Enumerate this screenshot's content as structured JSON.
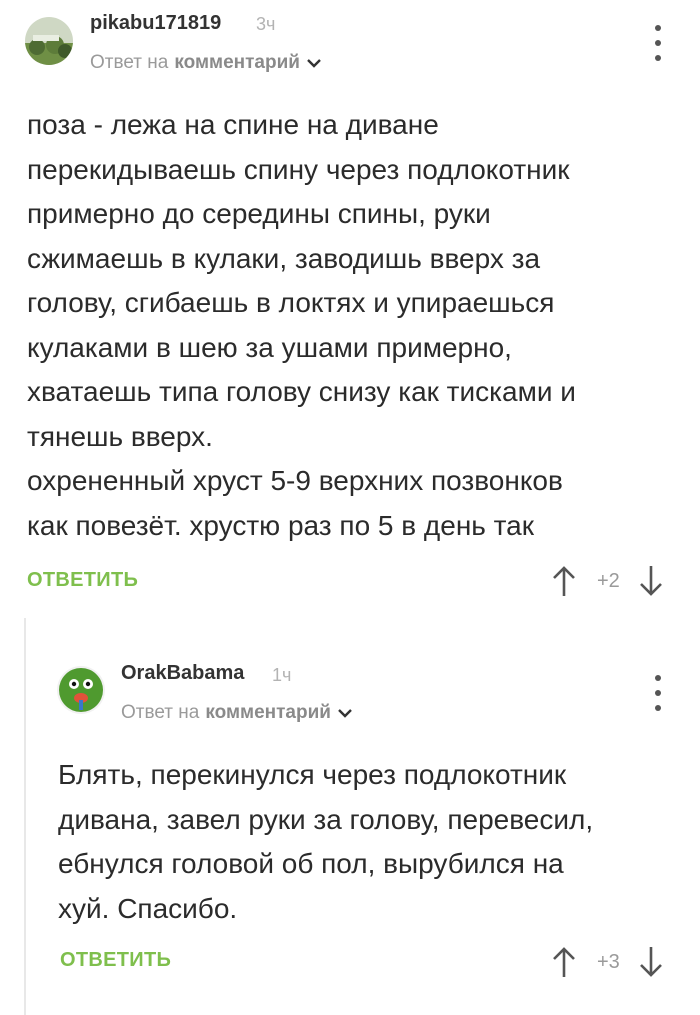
{
  "comments": [
    {
      "username": "pikabu171819",
      "time": "3ч",
      "reply_prefix": "Ответ на",
      "reply_target": "комментарий",
      "text": "поза - лежа на спине на диване\nперекидываешь спину через подлокотник\nпримерно до середины спины, руки\nсжимаешь в кулаки, заводишь вверх за\nголову, сгибаешь в локтях и упираешься\nкулаками в шею за ушами примерно,\nхватаешь типа голову снизу как тисками и\nтянешь вверх.\nохрененный хруст 5-9 верхних позвонков\nкак повезёт. хрустю раз по 5 в день так",
      "reply_label": "ОТВЕТИТЬ",
      "rating": "+2"
    },
    {
      "username": "OrakBabama",
      "time": "1ч",
      "reply_prefix": "Ответ на",
      "reply_target": "комментарий",
      "text": "Блять, перекинулся через подлокотник\nдивана, завел руки за голову, перевесил,\nебнулся головой об пол, вырубился на\nхуй. Спасибо.",
      "reply_label": "ОТВЕТИТЬ",
      "rating": "+3"
    }
  ],
  "colors": {
    "accent": "#7fbf4d",
    "muted": "#9a9a9a"
  },
  "icons": {
    "menu": "more-vertical-icon",
    "upvote": "arrow-up-icon",
    "downvote": "arrow-down-icon",
    "expand": "chevron-down-icon"
  }
}
